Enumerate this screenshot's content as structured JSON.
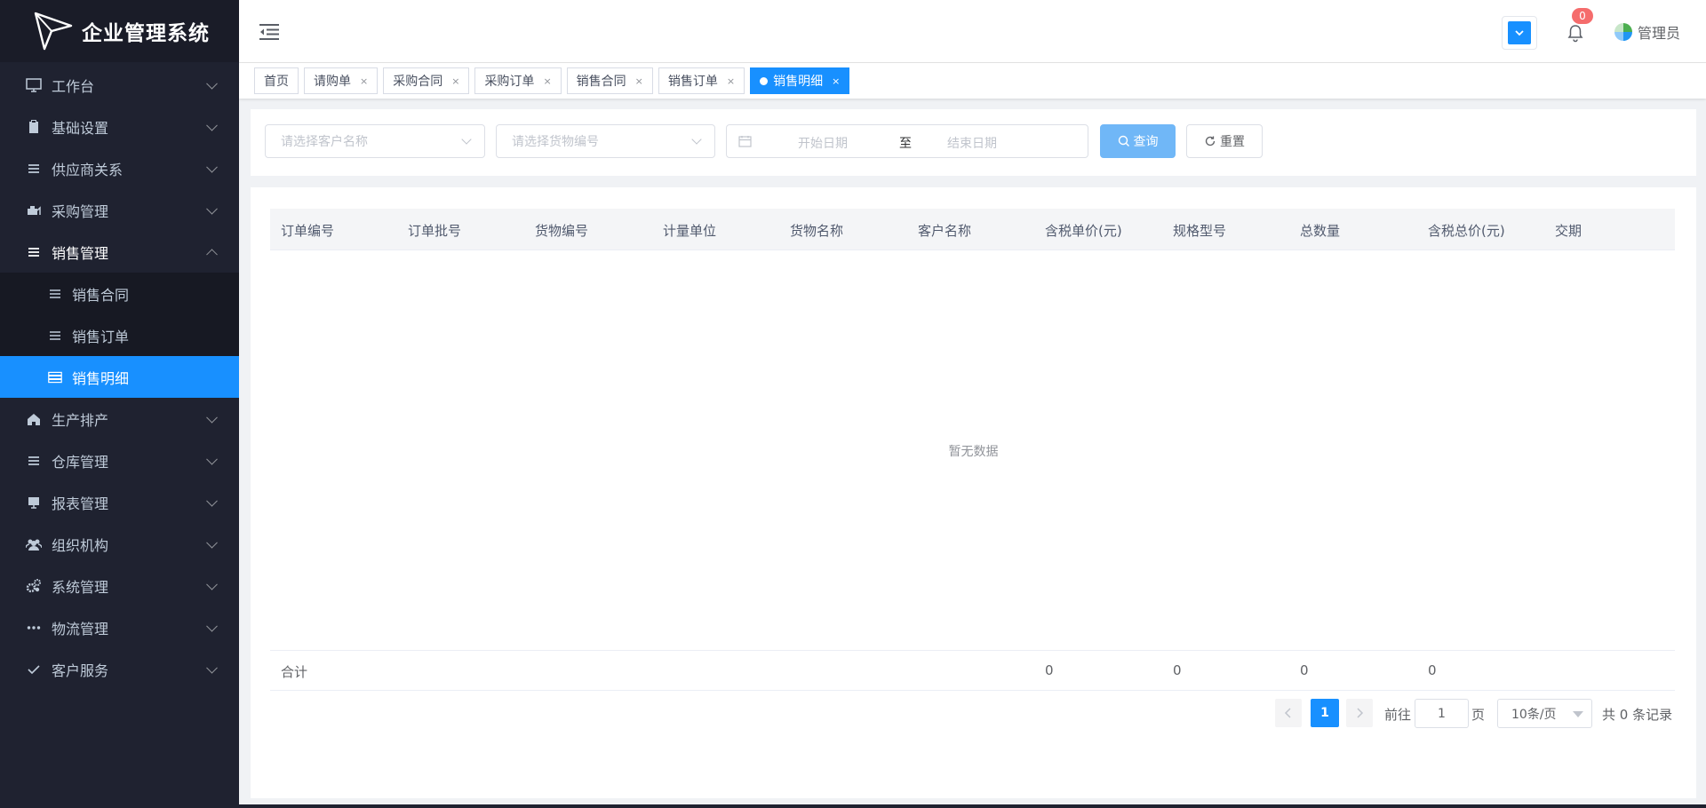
{
  "app": {
    "title": "企业管理系统"
  },
  "sidebar": {
    "items": [
      {
        "label": "工作台",
        "icon": "monitor-icon"
      },
      {
        "label": "基础设置",
        "icon": "clipboard-icon"
      },
      {
        "label": "供应商关系",
        "icon": "list-icon"
      },
      {
        "label": "采购管理",
        "icon": "cart-icon"
      },
      {
        "label": "销售管理",
        "icon": "list-icon",
        "expanded": true
      },
      {
        "label": "生产排产",
        "icon": "home-icon"
      },
      {
        "label": "仓库管理",
        "icon": "list-icon"
      },
      {
        "label": "报表管理",
        "icon": "screen-icon"
      },
      {
        "label": "组织机构",
        "icon": "users-icon"
      },
      {
        "label": "系统管理",
        "icon": "gears-icon"
      },
      {
        "label": "物流管理",
        "icon": "more-icon"
      },
      {
        "label": "客户服务",
        "icon": "check-icon"
      }
    ],
    "sales_submenu": [
      {
        "label": "销售合同"
      },
      {
        "label": "销售订单"
      },
      {
        "label": "销售明细",
        "active": true
      }
    ]
  },
  "header": {
    "notification_count": "0",
    "user_name": "管理员"
  },
  "tags": [
    {
      "label": "首页",
      "closable": false
    },
    {
      "label": "请购单",
      "closable": true
    },
    {
      "label": "采购合同",
      "closable": true
    },
    {
      "label": "采购订单",
      "closable": true
    },
    {
      "label": "销售合同",
      "closable": true
    },
    {
      "label": "销售订单",
      "closable": true
    },
    {
      "label": "销售明细",
      "closable": true,
      "active": true
    }
  ],
  "filter": {
    "customer_placeholder": "请选择客户名称",
    "goods_placeholder": "请选择货物编号",
    "start_placeholder": "开始日期",
    "range_separator": "至",
    "end_placeholder": "结束日期",
    "search_label": "查询",
    "reset_label": "重置"
  },
  "table": {
    "columns": [
      "订单编号",
      "订单批号",
      "货物编号",
      "计量单位",
      "货物名称",
      "客户名称",
      "含税单价(元)",
      "规格型号",
      "总数量",
      "含税总价(元)",
      "交期"
    ],
    "empty_text": "暂无数据",
    "summary": {
      "label": "合计",
      "unit_price": "0",
      "spec": "0",
      "quantity": "0",
      "total_price": "0"
    }
  },
  "pagination": {
    "current_page": "1",
    "goto_label": "前往",
    "goto_value": "1",
    "page_suffix": "页",
    "page_size": "10条/页",
    "total_text": "共 0 条记录"
  },
  "colors": {
    "sidebar_bg": "#1f2230",
    "accent": "#1890ff",
    "badge": "#f56c6c"
  }
}
